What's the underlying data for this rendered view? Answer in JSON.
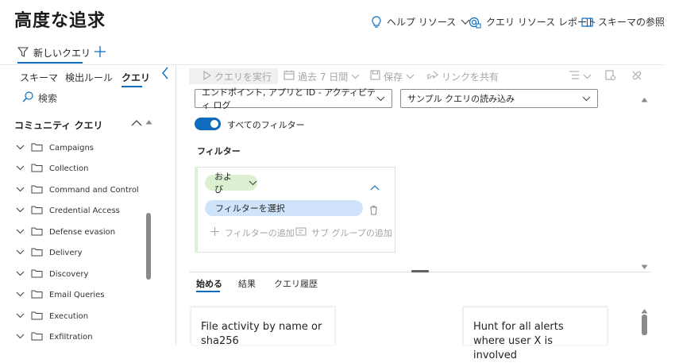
{
  "header": {
    "title": "高度な追求",
    "help_label": "ヘルプ リソース",
    "report_label": "クエリ リソース レポート",
    "schema_label": "スキーマの参照"
  },
  "query_tabs": {
    "new_query_label": "新しいクエリ",
    "add_icon": "plus-icon"
  },
  "left_panel": {
    "tabs": [
      "スキーマ",
      "検出ルール",
      "クエリ"
    ],
    "active_tab": "クエリ",
    "search_placeholder": "検索",
    "section_title": "コミュニティ クエリ",
    "folders": [
      "Campaigns",
      "Collection",
      "Command and Control",
      "Credential Access",
      "Defense evasion",
      "Delivery",
      "Discovery",
      "Email Queries",
      "Execution",
      "Exfiltration"
    ]
  },
  "toolbar": {
    "run_label": "クエリを実行",
    "time_range_label": "過去 7 日間",
    "save_label": "保存",
    "share_label": "リンクを共有"
  },
  "builder": {
    "source_select": "エンドポイント, アプリと ID - アクティビティ ログ",
    "sample_select": "サンプル クエリの読み込み",
    "all_filters_label": "すべてのフィルター",
    "all_filters_on": true,
    "filter_heading": "フィルター",
    "operator_label": "および",
    "select_filter_label": "フィルターを選択",
    "add_filter_label": "フィルターの追加",
    "add_subgroup_label": "サブ グループの追加"
  },
  "bottom": {
    "tabs": [
      "始める",
      "結果",
      "クエリ履歴"
    ],
    "active_tab": "始める",
    "cards": [
      "File activity by name or sha256",
      "Hunt for all alerts where user X is involved"
    ]
  },
  "colors": {
    "accent": "#0f6cbd",
    "and_pill": "#dcefd1",
    "filter_pill": "#cfe4fa"
  }
}
